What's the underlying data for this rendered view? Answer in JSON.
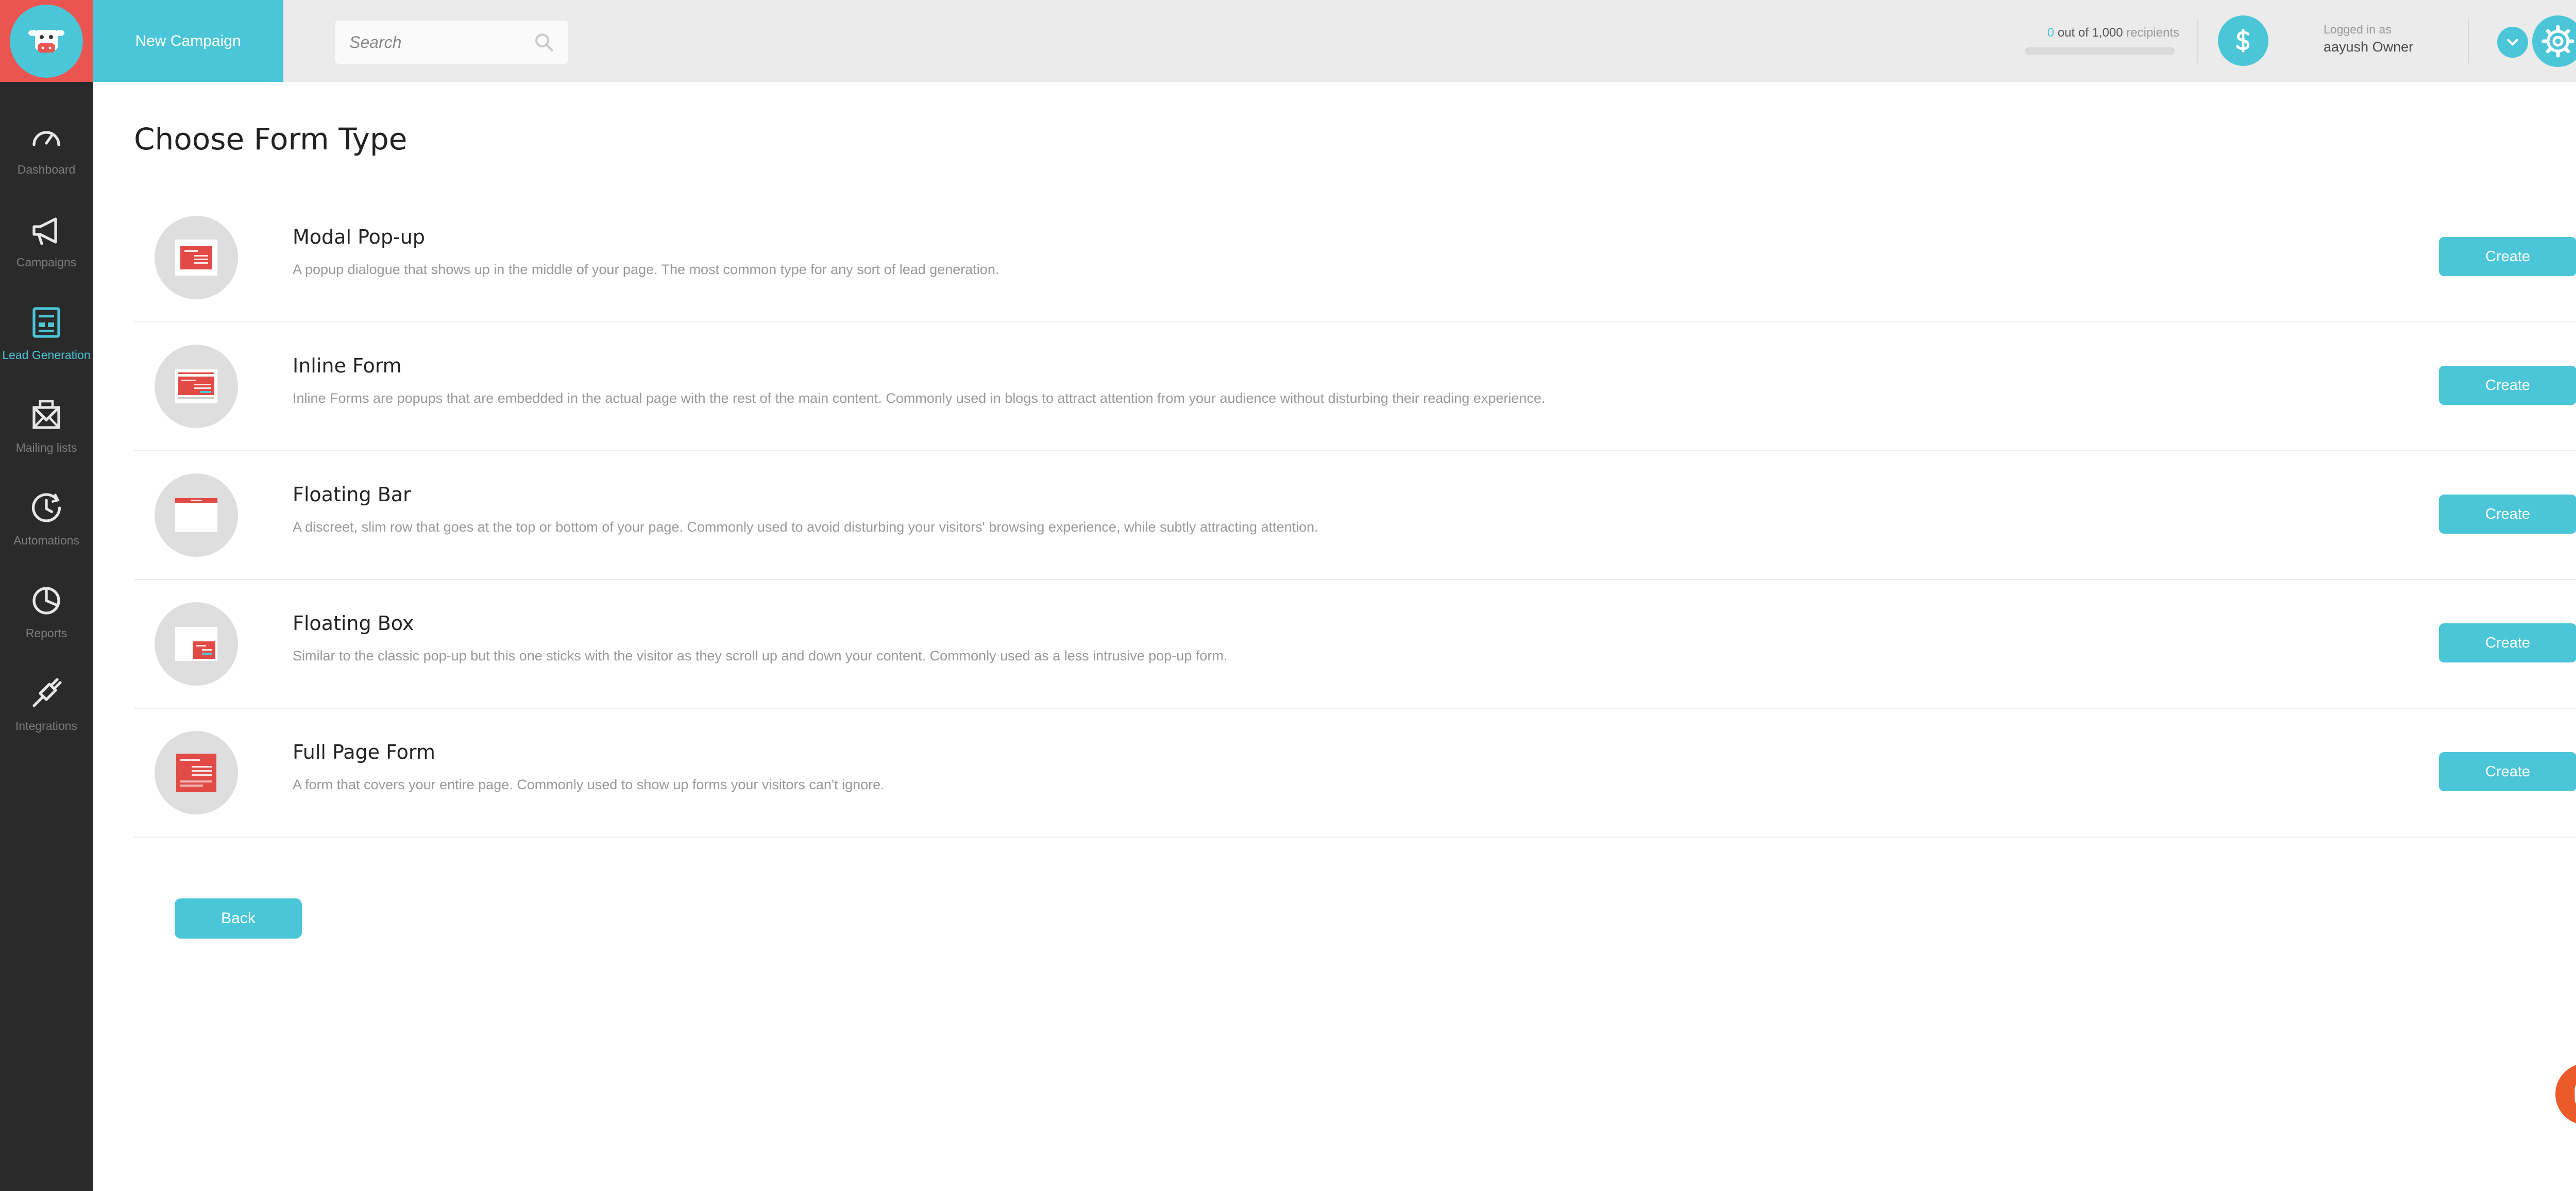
{
  "sidebar": {
    "items": [
      {
        "label": "Dashboard",
        "icon": "dashboard-icon"
      },
      {
        "label": "Campaigns",
        "icon": "megaphone-icon"
      },
      {
        "label": "Lead Generation",
        "icon": "form-icon"
      },
      {
        "label": "Mailing lists",
        "icon": "mail-icon"
      },
      {
        "label": "Automations",
        "icon": "clock-icon"
      },
      {
        "label": "Reports",
        "icon": "pie-chart-icon"
      },
      {
        "label": "Integrations",
        "icon": "plug-icon"
      }
    ],
    "active_index": 2
  },
  "header": {
    "new_campaign_label": "New Campaign",
    "search_placeholder": "Search",
    "recipients_count": "0",
    "recipients_middle": "out of",
    "recipients_limit": "1,000",
    "recipients_suffix": "recipients",
    "recipients_fraction": 0,
    "logged_in_label": "Logged in as",
    "user_name": "aayush Owner"
  },
  "main": {
    "title": "Choose Form Type",
    "forms": [
      {
        "name": "Modal Pop-up",
        "description": "A popup dialogue that shows up in the middle of your page. The most common type for any sort of lead generation.",
        "button": "Create",
        "icon": "modal-popup-icon"
      },
      {
        "name": "Inline Form",
        "description": "Inline Forms are popups that are embedded in the actual page with the rest of the main content. Commonly used in blogs to attract attention from your audience without disturbing their reading experience.",
        "button": "Create",
        "icon": "inline-form-icon"
      },
      {
        "name": "Floating Bar",
        "description": "A discreet, slim row that goes at the top or bottom of your page. Commonly used to avoid disturbing your visitors' browsing experience, while subtly attracting attention.",
        "button": "Create",
        "icon": "floating-bar-icon"
      },
      {
        "name": "Floating Box",
        "description": "Similar to the classic pop-up but this one sticks with the visitor as they scroll up and down your content. Commonly used as a less intrusive pop-up form.",
        "button": "Create",
        "icon": "floating-box-icon"
      },
      {
        "name": "Full Page Form",
        "description": "A form that covers your entire page. Commonly used to show up forms your visitors can't ignore.",
        "button": "Create",
        "icon": "full-page-form-icon"
      }
    ],
    "back_label": "Back"
  },
  "colors": {
    "accent": "#4bc6d8",
    "brand_red": "#ea5552",
    "sidebar_bg": "#2a2a2a",
    "chat": "#ec5a29"
  }
}
